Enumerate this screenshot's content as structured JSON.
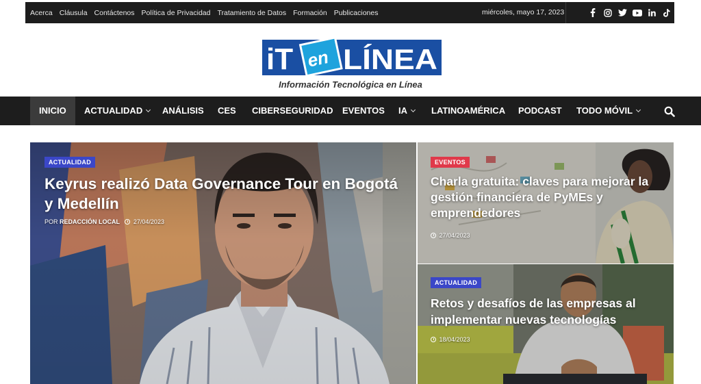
{
  "topbar": {
    "links": [
      "Acerca",
      "Cláusula",
      "Contáctenos",
      "Política de Privacidad",
      "Tratamiento de Datos",
      "Formación",
      "Publicaciones"
    ],
    "date": "miércoles, mayo 17, 2023",
    "social": [
      "facebook-icon",
      "instagram-icon",
      "twitter-icon",
      "youtube-icon",
      "linkedin-icon",
      "tiktok-icon"
    ]
  },
  "logo": {
    "part1": "iT",
    "part2": "en",
    "part3": "LÍNEA",
    "tagline": "Información Tecnológica en Línea"
  },
  "nav": {
    "items": [
      {
        "label": "INICIO",
        "active": true,
        "dropdown": false
      },
      {
        "label": "ACTUALIDAD",
        "active": false,
        "dropdown": true
      },
      {
        "label": "ANÁLISIS",
        "active": false,
        "dropdown": false
      },
      {
        "label": "CES",
        "active": false,
        "dropdown": false
      },
      {
        "label": "CIBERSEGURIDAD",
        "active": false,
        "dropdown": false
      },
      {
        "label": "EVENTOS",
        "active": false,
        "dropdown": false
      },
      {
        "label": "IA",
        "active": false,
        "dropdown": true
      },
      {
        "label": "LATINOAMÉRICA",
        "active": false,
        "dropdown": false
      },
      {
        "label": "PODCAST",
        "active": false,
        "dropdown": false
      },
      {
        "label": "TODO MÓVIL",
        "active": false,
        "dropdown": true
      }
    ]
  },
  "featured": {
    "category": "ACTUALIDAD",
    "title": "Keyrus realizó Data Governance Tour en Bogotá y Medellín",
    "by_prefix": "POR",
    "author": "REDACCIÓN LOCAL",
    "date": "27/04/2023"
  },
  "side_posts": [
    {
      "category": "EVENTOS",
      "title": "Charla gratuita: claves para mejorar la gestión financiera de PyMEs y emprendedores",
      "date": "27/04/2023"
    },
    {
      "category": "ACTUALIDAD",
      "title": "Retos y desafíos de las empresas al implementar nuevas tecnologías",
      "date": "18/04/2023"
    }
  ],
  "colors": {
    "dark": "#1d1d1d",
    "logo_blue": "#1a4fa3",
    "logo_light_blue": "#1ea3dd",
    "badge_blue": "#3b47c8",
    "badge_red": "#e0394a"
  }
}
